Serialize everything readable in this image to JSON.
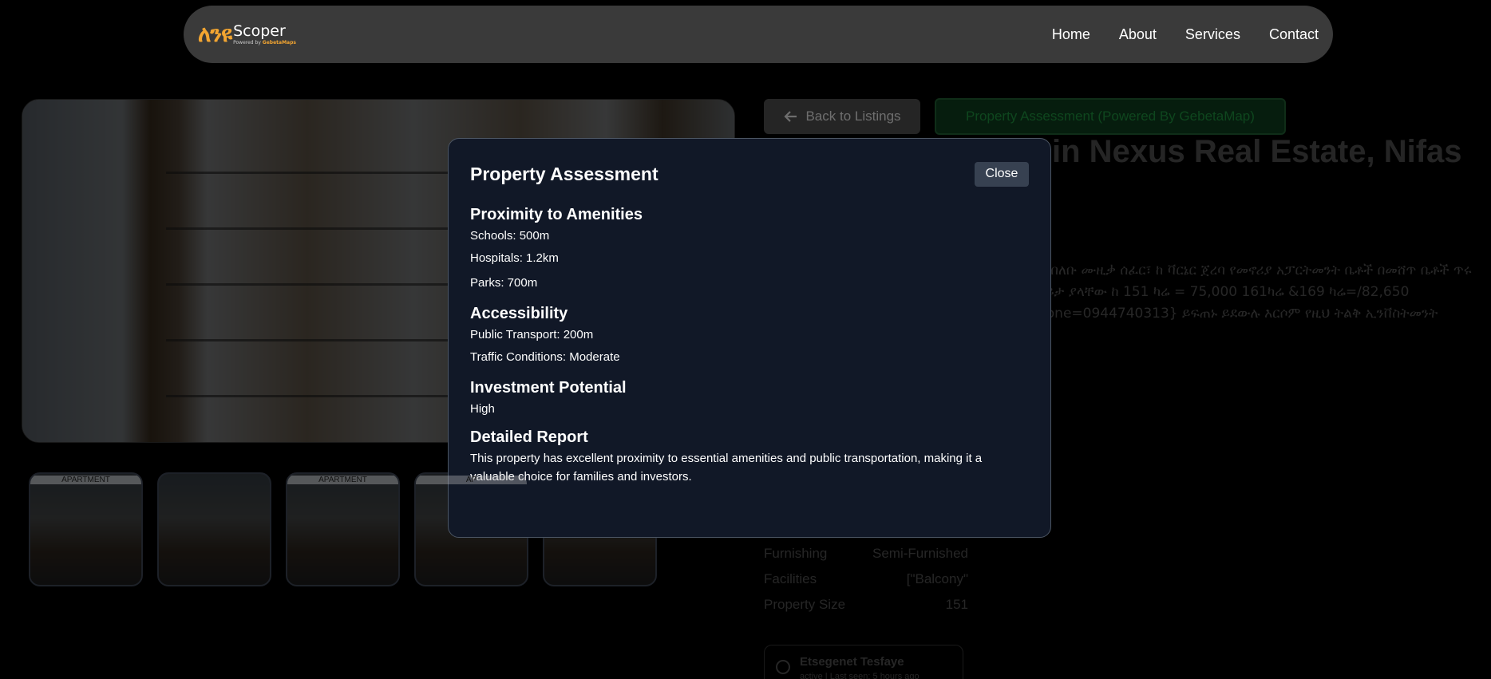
{
  "header": {
    "logo_mark": "ለንዩ",
    "logo_name": "Scoper",
    "logo_sub_prefix": "Powered by",
    "logo_sub_brand": "GebetaMaps",
    "nav": [
      "Home",
      "About",
      "Services",
      "Contact"
    ]
  },
  "gallery": {
    "thumb_tags": [
      "APARTMENT",
      "",
      "APARTMENT",
      "AP",
      ""
    ]
  },
  "actions": {
    "back_label": "Back to Listings",
    "assessment_label": "Property Assessment (Powered By GebetaMap)"
  },
  "listing": {
    "title_partial": "in Nexus Real Estate, Nifas",
    "description_partial": "ፋ በለቡ ሙዚቃ ሰፈር፣ ከ ቫርኔር ጀረባ የመኖሪያ አፓርትመንት ቤቶች በመሸጥ ቤቶች ጥሩ እይታ ያላቸው ከ 151 ካሬ = 75,000 161ካሬ &169 ካሬ=/82,650 hone=0944740313} ይፍጠኑ ይደውሉ እርሶም የዚህ ትልቅ ኢንቨስትመንት",
    "specs": [
      {
        "label": "Furnishing",
        "value": "Semi-Furnished"
      },
      {
        "label": "Facilities",
        "value": "[\"Balcony\""
      },
      {
        "label": "Property Size",
        "value": "151"
      }
    ],
    "agent_name": "Etsegenet Tesfaye",
    "agent_status": "active | Last seen: 5 hours ago"
  },
  "modal": {
    "title": "Property Assessment",
    "close_label": "Close",
    "amenities": {
      "heading": "Proximity to Amenities",
      "schools": "Schools: 500m",
      "hospitals": "Hospitals: 1.2km",
      "parks": "Parks: 700m"
    },
    "accessibility": {
      "heading": "Accessibility",
      "transport": "Public Transport: 200m",
      "traffic": "Traffic Conditions: Moderate"
    },
    "investment": {
      "heading": "Investment Potential",
      "value": "High"
    },
    "report": {
      "heading": "Detailed Report",
      "text": "This property has excellent proximity to essential amenities and public transportation, making it a valuable choice for families and investors."
    }
  },
  "colors": {
    "accent": "#f2a531",
    "modal_bg": "#111827",
    "assessment_btn_text": "#1d8d3c"
  }
}
